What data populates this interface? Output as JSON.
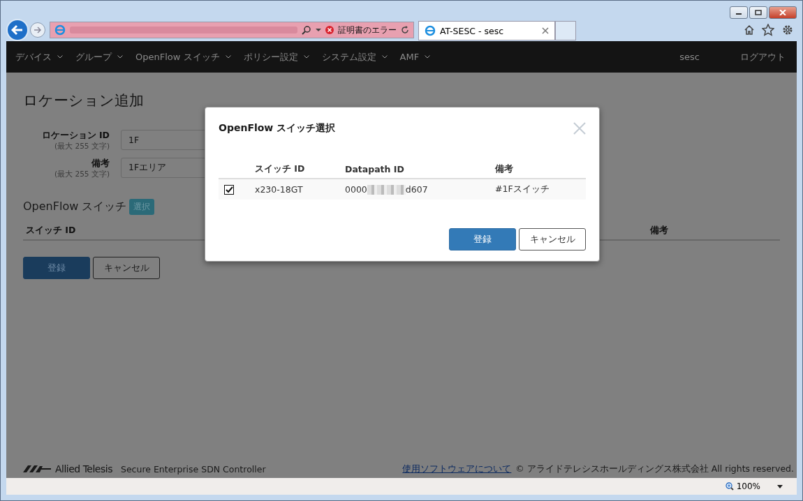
{
  "browser": {
    "address_status": "証明書のエラー",
    "tab_title": "AT-SESC - sesc",
    "zoom": "100%"
  },
  "nav": {
    "items": [
      {
        "label": "デバイス",
        "caret": true
      },
      {
        "label": "グループ",
        "caret": true
      },
      {
        "label": "OpenFlow スイッチ",
        "caret": true
      },
      {
        "label": "ポリシー設定",
        "caret": true
      },
      {
        "label": "システム設定",
        "caret": true
      },
      {
        "label": "AMF",
        "caret": true
      }
    ],
    "user": "sesc",
    "logout": "ログアウト"
  },
  "page": {
    "title": "ロケーション追加",
    "fields": [
      {
        "label": "ロケーション ID",
        "hint": "(最大 255 文字)",
        "value": "1F"
      },
      {
        "label": "備考",
        "hint": "(最大 255 文字)",
        "value": "1Fエリア"
      }
    ],
    "switch_section": {
      "title": "OpenFlow スイッチ",
      "select_button": "選択",
      "columns": [
        "スイッチ ID",
        "備考"
      ]
    },
    "buttons": {
      "submit": "登録",
      "cancel": "キャンセル"
    }
  },
  "modal": {
    "title": "OpenFlow スイッチ選択",
    "columns": [
      "スイッチ ID",
      "Datapath ID",
      "備考"
    ],
    "rows": [
      {
        "checked": true,
        "switch_id": "x230-18GT",
        "datapath_start": "0000",
        "datapath_end": "d607",
        "note": "#1Fスイッチ"
      }
    ],
    "buttons": {
      "submit": "登録",
      "cancel": "キャンセル"
    }
  },
  "footer": {
    "brand": "Allied Telesis",
    "product": "Secure Enterprise SDN Controller",
    "link": "使用ソフトウェアについて",
    "copyright": "© アライドテレシスホールディングス株式会社 All rights reserved."
  }
}
